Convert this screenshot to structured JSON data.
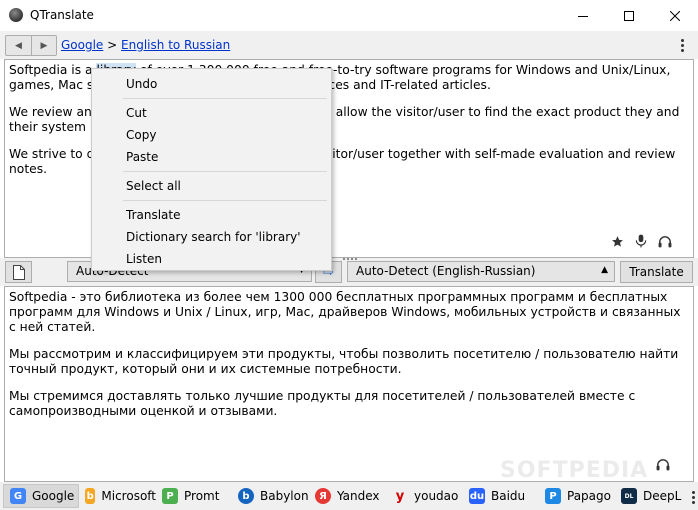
{
  "window": {
    "title": "QTranslate"
  },
  "breadcrumb": {
    "service": "Google",
    "separator": ">",
    "direction": "English to Russian"
  },
  "source": {
    "paragraphs": [
      {
        "before": "Softpedia is a ",
        "selected": "library",
        "after": " of over 1,300,000 free and free-to-try software programs for Windows and Unix/Linux, games, Mac software, Windows drivers, mobile devices and IT-related articles."
      },
      {
        "text": "We review and categorize these products in order to allow the visitor/user to find the exact product they and their system needs."
      },
      {
        "text": "We strive to deliver only the best products to the visitor/user together with self-made evaluation and review notes."
      }
    ]
  },
  "controls": {
    "source_lang": "Auto-Detect",
    "target_lang": "Auto-Detect (English-Russian)",
    "translate_label": "Translate"
  },
  "target": {
    "paragraphs": [
      "Softpedia - это библиотека из более чем 1300 000 бесплатных программных программ и бесплатных программ для Windows и Unix / Linux, игр, Mac, драйверов Windows, мобильных устройств и связанных с ней статей.",
      "Мы рассмотрим и классифицируем эти продукты, чтобы позволить посетителю / пользователю найти точный продукт, который они и их системные потребности.",
      "Мы стремимся доставлять только лучшие продукты для посетителей / пользователей вместе с самопроизводными оценкой и отзывами."
    ]
  },
  "context_menu": {
    "undo": "Undo",
    "cut": "Cut",
    "copy": "Copy",
    "paste": "Paste",
    "select_all": "Select all",
    "translate": "Translate",
    "dictionary": "Dictionary search for 'library'",
    "listen": "Listen"
  },
  "services": [
    {
      "name": "Google",
      "icon": "google-icon",
      "color": "#4285f4",
      "active": true
    },
    {
      "name": "Microsoft",
      "icon": "bing-icon",
      "color": "#f5a623"
    },
    {
      "name": "Promt",
      "icon": "promt-icon",
      "color": "#4caf50"
    },
    {
      "name": "Babylon",
      "icon": "babylon-icon",
      "color": "#1565c0"
    },
    {
      "name": "Yandex",
      "icon": "yandex-icon",
      "color": "#e53935"
    },
    {
      "name": "youdao",
      "icon": "youdao-icon",
      "color": "#d50000"
    },
    {
      "name": "Baidu",
      "icon": "baidu-icon",
      "color": "#2962ff"
    },
    {
      "name": "Papago",
      "icon": "papago-icon",
      "color": "#1e88e5"
    },
    {
      "name": "DeepL",
      "icon": "deepl-icon",
      "color": "#0f2b46"
    }
  ],
  "watermark": "SOFTPEDIA"
}
